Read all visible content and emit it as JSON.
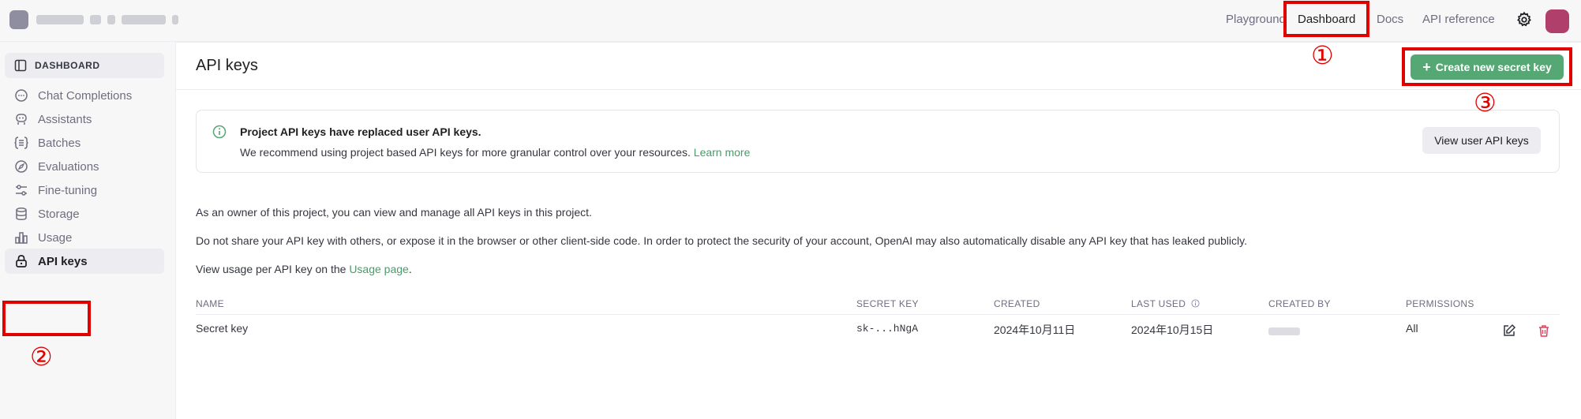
{
  "topbar": {
    "nav": {
      "playground": "Playground",
      "dashboard": "Dashboard",
      "docs": "Docs",
      "api_reference": "API reference"
    }
  },
  "sidebar": {
    "header": "DASHBOARD",
    "items": [
      {
        "label": "Chat Completions",
        "icon": "chat-icon"
      },
      {
        "label": "Assistants",
        "icon": "assistant-icon"
      },
      {
        "label": "Batches",
        "icon": "batches-icon"
      },
      {
        "label": "Evaluations",
        "icon": "evaluations-icon"
      },
      {
        "label": "Fine-tuning",
        "icon": "sliders-icon"
      },
      {
        "label": "Storage",
        "icon": "database-icon"
      },
      {
        "label": "Usage",
        "icon": "bar-chart-icon"
      },
      {
        "label": "API keys",
        "icon": "lock-icon",
        "active": true
      }
    ]
  },
  "main": {
    "title": "API keys",
    "create_button": "Create new secret key",
    "notice": {
      "title": "Project API keys have replaced user API keys.",
      "text": "We recommend using project based API keys for more granular control over your resources.",
      "link": "Learn more",
      "button": "View user API keys"
    },
    "descriptions": [
      "As an owner of this project, you can view and manage all API keys in this project.",
      "Do not share your API key with others, or expose it in the browser or other client-side code. In order to protect the security of your account, OpenAI may also automatically disable any API key that has leaked publicly."
    ],
    "usage_prefix": "View usage per API key on the",
    "usage_link": "Usage page",
    "usage_suffix": ".",
    "table": {
      "headers": {
        "name": "NAME",
        "secret_key": "SECRET KEY",
        "created": "CREATED",
        "last_used": "LAST USED",
        "created_by": "CREATED BY",
        "permissions": "PERMISSIONS"
      },
      "rows": [
        {
          "name": "Secret key",
          "secret_key": "sk-...hNgA",
          "created": "2024年10月11日",
          "last_used": "2024年10月15日",
          "permissions": "All"
        }
      ]
    }
  },
  "annotations": {
    "marker_1": "①",
    "marker_2": "②",
    "marker_3": "③"
  },
  "colors": {
    "accent_green": "#55a773",
    "link_green": "#4a9b69",
    "annotation_red": "#e00000",
    "delete_red": "#e0435b"
  }
}
